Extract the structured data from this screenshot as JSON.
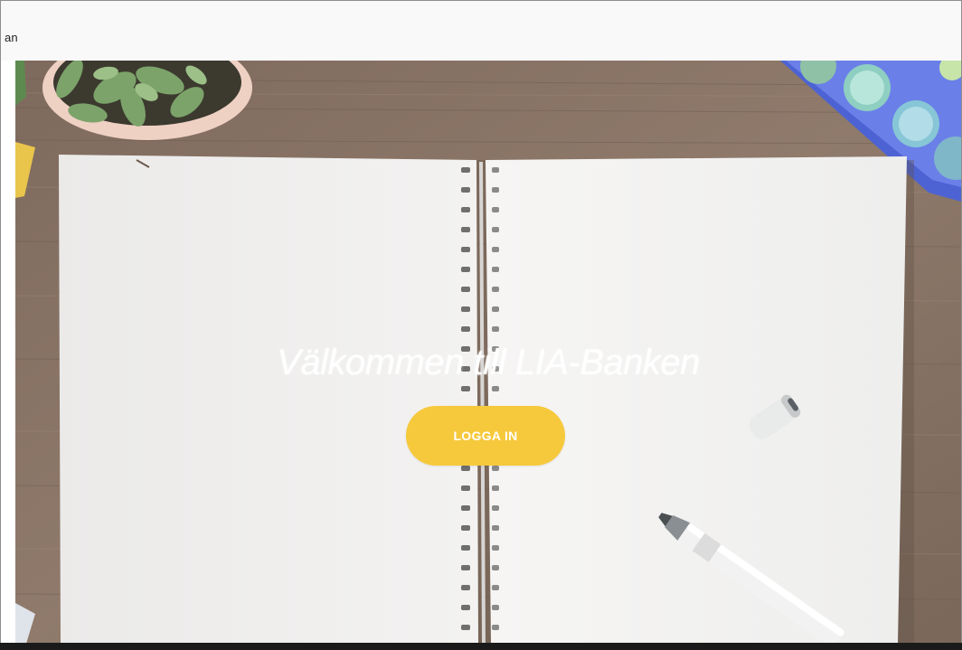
{
  "topbar": {
    "brand_fragment": "an"
  },
  "hero": {
    "title": "Välkommen till LIA-Banken",
    "button_label": "LOGGA IN"
  },
  "colors": {
    "button": "#f6c93c",
    "wood": "#8a7566",
    "paper": "#f1f0ef"
  }
}
